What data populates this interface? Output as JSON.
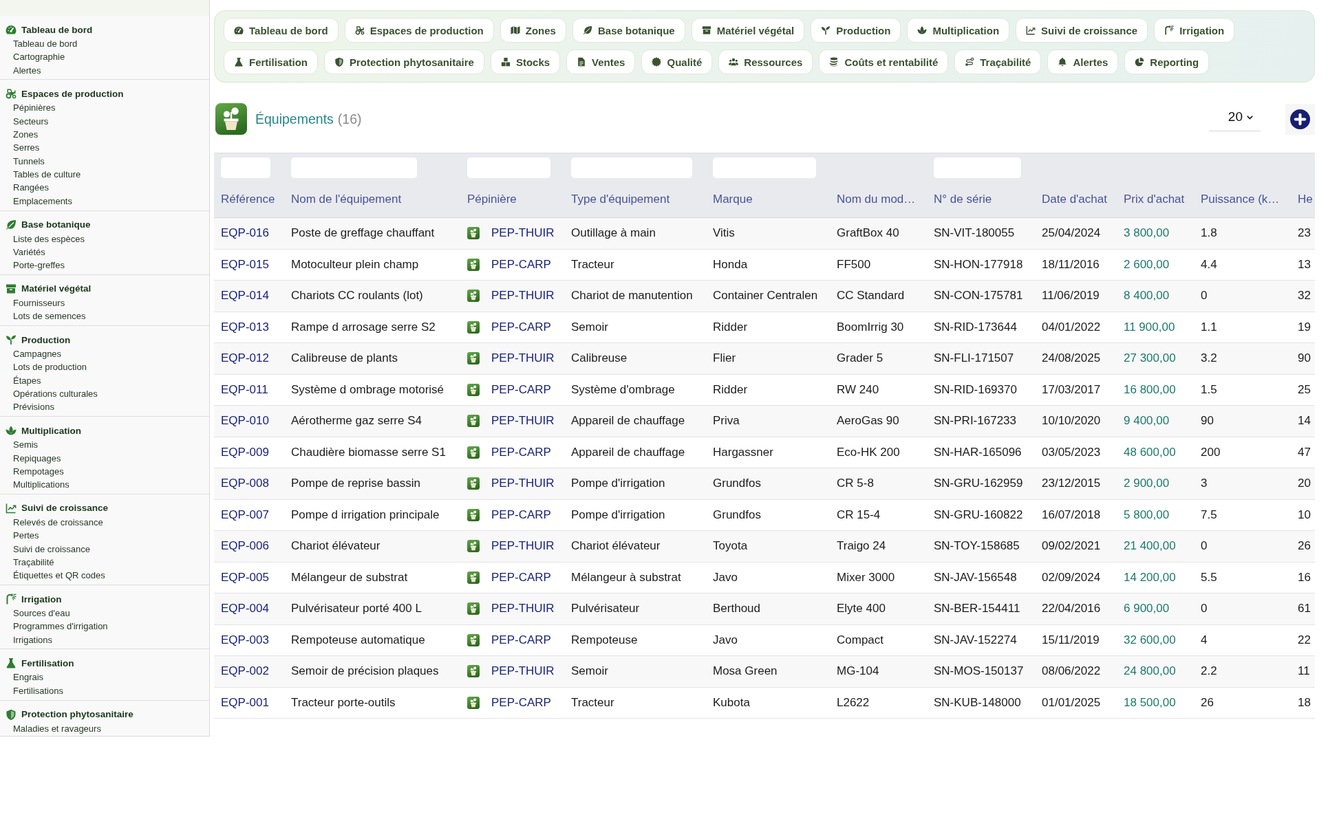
{
  "sidebar": {
    "sections": [
      {
        "title": "Tableau de bord",
        "items": [
          "Tableau de bord",
          "Cartographie",
          "Alertes"
        ]
      },
      {
        "title": "Espaces de production",
        "items": [
          "Pépinières",
          "Secteurs",
          "Zones",
          "Serres",
          "Tunnels",
          "Tables de culture",
          "Rangées",
          "Emplacements"
        ]
      },
      {
        "title": "Base botanique",
        "items": [
          "Liste des espèces",
          "Variétés",
          "Porte-greffes"
        ]
      },
      {
        "title": "Matériel végétal",
        "items": [
          "Fournisseurs",
          "Lots de semences"
        ]
      },
      {
        "title": "Production",
        "items": [
          "Campagnes",
          "Lots de production",
          "Étapes",
          "Opérations culturales",
          "Prévisions"
        ]
      },
      {
        "title": "Multiplication",
        "items": [
          "Semis",
          "Repiquages",
          "Rempotages",
          "Multiplications"
        ]
      },
      {
        "title": "Suivi de croissance",
        "items": [
          "Relevés de croissance",
          "Pertes",
          "Suivi de croissance",
          "Traçabilité",
          "Étiquettes et QR codes"
        ]
      },
      {
        "title": "Irrigation",
        "items": [
          "Sources d'eau",
          "Programmes d'irrigation",
          "Irrigations"
        ]
      },
      {
        "title": "Fertilisation",
        "items": [
          "Engrais",
          "Fertilisations"
        ]
      },
      {
        "title": "Protection phytosanitaire",
        "items": [
          "Maladies et ravageurs"
        ]
      }
    ]
  },
  "nav": {
    "items": [
      "Tableau de bord",
      "Espaces de production",
      "Zones",
      "Base botanique",
      "Matériel végétal",
      "Production",
      "Multiplication",
      "Suivi de croissance",
      "Irrigation",
      "Fertilisation",
      "Protection phytosanitaire",
      "Stocks",
      "Ventes",
      "Qualité",
      "Ressources",
      "Coûts et rentabilité",
      "Traçabilité",
      "Alertes",
      "Reporting"
    ]
  },
  "header": {
    "title": "Équipements",
    "count": "(16)",
    "page_size": "20"
  },
  "table": {
    "columns": [
      {
        "label": "Référence",
        "kind": "link",
        "filter": true
      },
      {
        "label": "Nom de l'équipement",
        "kind": "text",
        "filter": true
      },
      {
        "label": "Pépinière",
        "kind": "nursery",
        "filter": true
      },
      {
        "label": "Type d'équipement",
        "kind": "text",
        "filter": true
      },
      {
        "label": "Marque",
        "kind": "text",
        "filter": true
      },
      {
        "label": "Nom du mod…",
        "kind": "text",
        "filter": false
      },
      {
        "label": "N° de série",
        "kind": "text",
        "filter": true
      },
      {
        "label": "Date d'achat",
        "kind": "text",
        "filter": false
      },
      {
        "label": "Prix d'achat",
        "kind": "price",
        "filter": false
      },
      {
        "label": "Puissance (k…",
        "kind": "text",
        "filter": false
      },
      {
        "label": "He",
        "kind": "text",
        "filter": false
      }
    ],
    "rows": [
      [
        "EQP-016",
        "Poste de greffage chauffant",
        "PEP-THUIR",
        "Outillage à main",
        "Vitis",
        "GraftBox 40",
        "SN-VIT-180055",
        "25/04/2024",
        "3 800,00",
        "1.8",
        "23"
      ],
      [
        "EQP-015",
        "Motoculteur plein champ",
        "PEP-CARP",
        "Tracteur",
        "Honda",
        "FF500",
        "SN-HON-177918",
        "18/11/2016",
        "2 600,00",
        "4.4",
        "13"
      ],
      [
        "EQP-014",
        "Chariots CC roulants (lot)",
        "PEP-THUIR",
        "Chariot de manutention",
        "Container Centralen",
        "CC Standard",
        "SN-CON-175781",
        "11/06/2019",
        "8 400,00",
        "0",
        "32"
      ],
      [
        "EQP-013",
        "Rampe d arrosage serre S2",
        "PEP-CARP",
        "Semoir",
        "Ridder",
        "BoomIrrig 30",
        "SN-RID-173644",
        "04/01/2022",
        "11 900,00",
        "1.1",
        "19"
      ],
      [
        "EQP-012",
        "Calibreuse de plants",
        "PEP-THUIR",
        "Calibreuse",
        "Flier",
        "Grader 5",
        "SN-FLI-171507",
        "24/08/2025",
        "27 300,00",
        "3.2",
        "90"
      ],
      [
        "EQP-011",
        "Système d ombrage motorisé",
        "PEP-CARP",
        "Système d'ombrage",
        "Ridder",
        "RW 240",
        "SN-RID-169370",
        "17/03/2017",
        "16 800,00",
        "1.5",
        "25"
      ],
      [
        "EQP-010",
        "Aérotherme gaz serre S4",
        "PEP-THUIR",
        "Appareil de chauffage",
        "Priva",
        "AeroGas 90",
        "SN-PRI-167233",
        "10/10/2020",
        "9 400,00",
        "90",
        "14"
      ],
      [
        "EQP-009",
        "Chaudière biomasse serre S1",
        "PEP-CARP",
        "Appareil de chauffage",
        "Hargassner",
        "Eco-HK 200",
        "SN-HAR-165096",
        "03/05/2023",
        "48 600,00",
        "200",
        "47"
      ],
      [
        "EQP-008",
        "Pompe de reprise bassin",
        "PEP-THUIR",
        "Pompe d'irrigation",
        "Grundfos",
        "CR 5-8",
        "SN-GRU-162959",
        "23/12/2015",
        "2 900,00",
        "3",
        "20"
      ],
      [
        "EQP-007",
        "Pompe d irrigation principale",
        "PEP-CARP",
        "Pompe d'irrigation",
        "Grundfos",
        "CR 15-4",
        "SN-GRU-160822",
        "16/07/2018",
        "5 800,00",
        "7.5",
        "10"
      ],
      [
        "EQP-006",
        "Chariot élévateur",
        "PEP-THUIR",
        "Chariot élévateur",
        "Toyota",
        "Traigo 24",
        "SN-TOY-158685",
        "09/02/2021",
        "21 400,00",
        "0",
        "26"
      ],
      [
        "EQP-005",
        "Mélangeur de substrat",
        "PEP-CARP",
        "Mélangeur à substrat",
        "Javo",
        "Mixer 3000",
        "SN-JAV-156548",
        "02/09/2024",
        "14 200,00",
        "5.5",
        "16"
      ],
      [
        "EQP-004",
        "Pulvérisateur porté 400 L",
        "PEP-THUIR",
        "Pulvérisateur",
        "Berthoud",
        "Elyte 400",
        "SN-BER-154411",
        "22/04/2016",
        "6 900,00",
        "0",
        "61"
      ],
      [
        "EQP-003",
        "Rempoteuse automatique",
        "PEP-CARP",
        "Rempoteuse",
        "Javo",
        "Compact",
        "SN-JAV-152274",
        "15/11/2019",
        "32 600,00",
        "4",
        "22"
      ],
      [
        "EQP-002",
        "Semoir de précision plaques",
        "PEP-THUIR",
        "Semoir",
        "Mosa Green",
        "MG-104",
        "SN-MOS-150137",
        "08/06/2022",
        "24 800,00",
        "2.2",
        "11"
      ],
      [
        "EQP-001",
        "Tracteur porte-outils",
        "PEP-CARP",
        "Tracteur",
        "Kubota",
        "L2622",
        "SN-KUB-148000",
        "01/01/2025",
        "18 500,00",
        "26",
        "18"
      ]
    ]
  }
}
